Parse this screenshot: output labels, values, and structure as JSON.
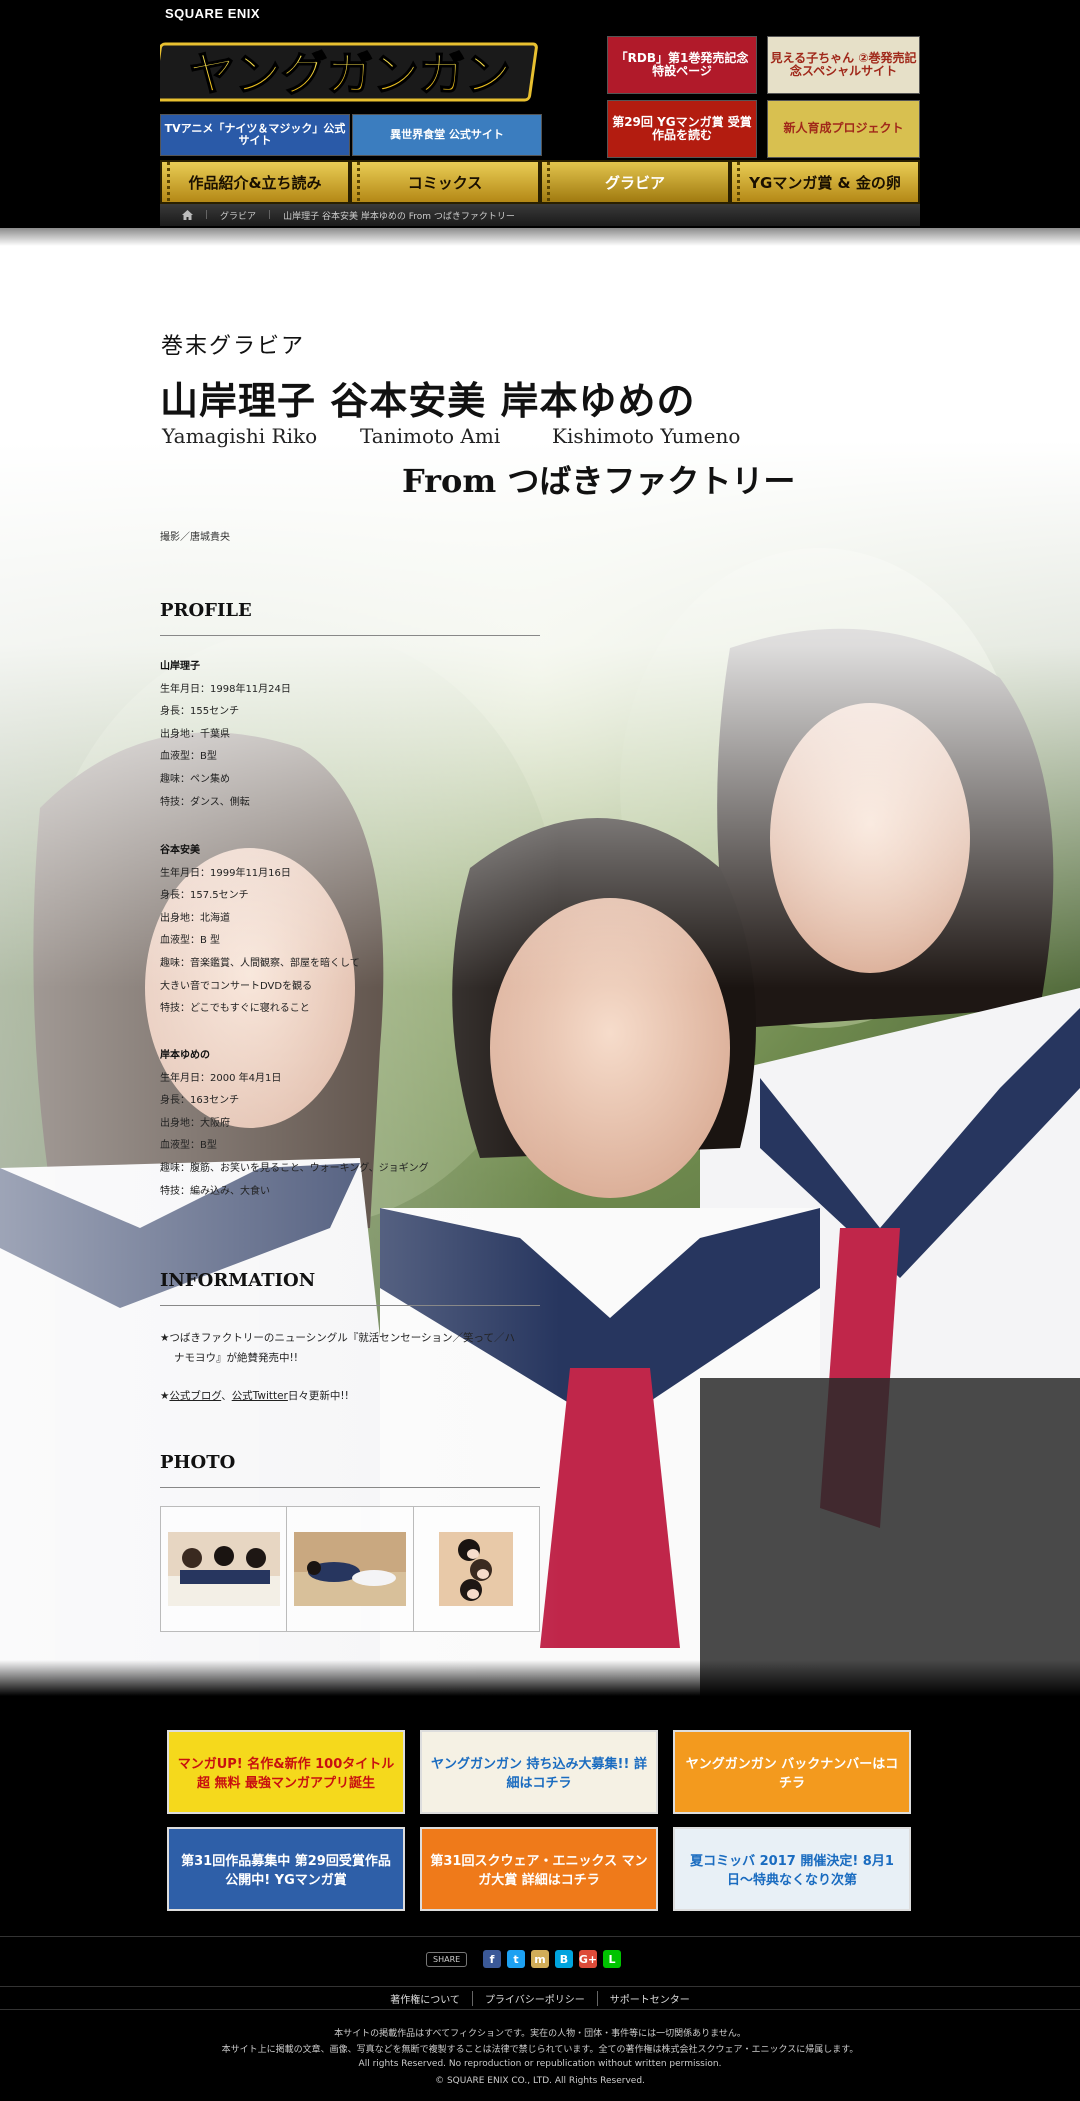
{
  "header": {
    "brand": "SQUARE ENIX",
    "logo_text": "ヤングガンガン",
    "banners": [
      {
        "text": "TVアニメ「ナイツ＆マジック」公式サイト",
        "color": "#2a5aa8"
      },
      {
        "text": "異世界食堂 公式サイト",
        "color": "#3b7dbf"
      },
      {
        "text": "「RDB」第1巻発売記念 特設ページ",
        "color": "#b11a2a"
      },
      {
        "text": "見える子ちゃん ②巻発売記念スペシャルサイト",
        "color": "#e6e0c8"
      },
      {
        "text": "第29回 YGマンガ賞 受賞作品を読む",
        "color": "#b31c10"
      },
      {
        "text": "新人育成プロジェクト",
        "color": "#d8c050"
      }
    ],
    "nav": [
      "作品紹介&立ち読み",
      "コミックス",
      "グラビア",
      "YGマンガ賞 & 金の卵"
    ],
    "breadcrumb": [
      "グラビア",
      "山岸理子 谷本安美 岸本ゆめの From つばきファクトリー"
    ]
  },
  "article": {
    "category": "巻末グラビア",
    "title": "山岸理子 谷本安美 岸本ゆめの",
    "romaji": [
      "Yamagishi Riko",
      "Tanimoto Ami",
      "Kishimoto Yumeno"
    ],
    "from": "From つばきファクトリー",
    "credit": "撮影／唐城貴央",
    "profile_heading": "PROFILE",
    "profiles": [
      {
        "name": "山岸理子",
        "lines": [
          "生年月日：1998年11月24日",
          "身長：155センチ",
          "出身地：千葉県",
          "血液型：B型",
          "趣味：ペン集め",
          "特技：ダンス、側転"
        ]
      },
      {
        "name": "谷本安美",
        "lines": [
          "生年月日：1999年11月16日",
          "身長：157.5センチ",
          "出身地：北海道",
          "血液型：B 型",
          "趣味：音楽鑑賞、人間観察、部屋を暗くして",
          "大きい音でコンサートDVDを観る",
          "特技：どこでもすぐに寝れること"
        ]
      },
      {
        "name": "岸本ゆめの",
        "lines": [
          "生年月日：2000 年4月1日",
          "身長：163センチ",
          "出身地：大阪府",
          "血液型：B型",
          "趣味：腹筋、お笑いを見ること、ウォーキング、ジョギング",
          "特技：編み込み、大食い"
        ]
      }
    ],
    "info_heading": "INFORMATION",
    "info1": "★つばきファクトリーのニューシングル『就活センセーション／笑って／ハ",
    "info1b": "ナモヨウ』が絶賛発売中!!",
    "info2_star": "★",
    "info2_link1": "公式ブログ",
    "info2_sep": "、",
    "info2_link2": "公式Twitter",
    "info2_tail": "日々更新中!!",
    "photo_heading": "PHOTO"
  },
  "promos": [
    {
      "text": "マンガUP! 名作&新作 100タイトル超 無料 最強マンガアプリ誕生",
      "bg": "#f5d91c",
      "fg": "#c81010"
    },
    {
      "text": "ヤングガンガン 持ち込み大募集!! 詳細はコチラ",
      "bg": "#f5f1e4",
      "fg": "#1a6cc0"
    },
    {
      "text": "ヤングガンガン バックナンバーはコチラ",
      "bg": "#f39a1e",
      "fg": "#fff"
    },
    {
      "text": "第31回作品募集中 第29回受賞作品公開中! YGマンガ賞",
      "bg": "#2e5fa8",
      "fg": "#fff"
    },
    {
      "text": "第31回スクウェア・エニックス マンガ大賞 詳細はコチラ",
      "bg": "#ef7a1a",
      "fg": "#fff"
    },
    {
      "text": "夏コミッバ 2017 開催決定! 8月1日〜特典なくなり次第",
      "bg": "#e8f0f6",
      "fg": "#1a6cc0"
    }
  ],
  "footer": {
    "share_label": "SHARE",
    "social": [
      {
        "icon": "facebook-icon",
        "glyph": "f",
        "color": "#3b5998"
      },
      {
        "icon": "twitter-icon",
        "glyph": "t",
        "color": "#1da1f2"
      },
      {
        "icon": "mixi-icon",
        "glyph": "m",
        "color": "#d1ad59"
      },
      {
        "icon": "hatena-icon",
        "glyph": "B",
        "color": "#00a4de"
      },
      {
        "icon": "google-plus-icon",
        "glyph": "G+",
        "color": "#dd4b39"
      },
      {
        "icon": "line-icon",
        "glyph": "L",
        "color": "#00c300"
      }
    ],
    "links": [
      "著作権について",
      "プライバシーポリシー",
      "サポートセンター"
    ],
    "notice1": "本サイトの掲載作品はすべてフィクションです。実在の人物・団体・事件等には一切関係ありません。",
    "notice2": "本サイト上に掲載の文章、画像、写真などを無断で複製することは法律で禁じられています。全ての著作権は株式会社スクウェア・エニックスに帰属します。",
    "notice3": "All rights Reserved. No reproduction or republication without written permission.",
    "copyright": "© SQUARE ENIX CO., LTD. All Rights Reserved."
  }
}
